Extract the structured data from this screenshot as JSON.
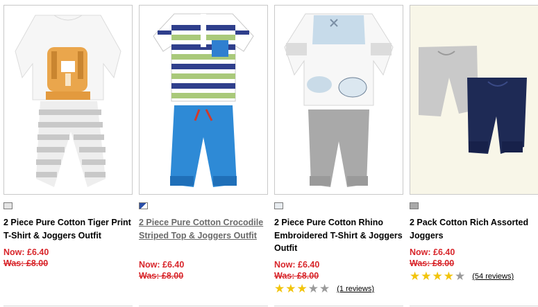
{
  "products": [
    {
      "swatch_color": "#e4e4e4",
      "title": "2 Piece Pure Cotton Tiger Print T-Shirt & Joggers Outfit",
      "now": "Now: £6.40",
      "was": "Was: £8.00"
    },
    {
      "swatch_color": "#2b4fa8",
      "title": "2 Piece Pure Cotton Crocodile Striped Top & Joggers Outfit",
      "now": "Now: £6.40",
      "was": "Was: £8.00"
    },
    {
      "swatch_color": "#e8ecf0",
      "title": "2 Piece Pure Cotton Rhino Embroidered T-Shirt & Joggers Outfit",
      "now": "Now: £6.40",
      "was": "Was: £8.00",
      "rating": 3,
      "rating_max": 5,
      "reviews": "(1 reviews)"
    },
    {
      "swatch_color": "#a9a9a9",
      "title": "2 Pack Cotton Rich Assorted Joggers",
      "now": "Now: £6.40",
      "was": "Was: £8.00",
      "rating": 4,
      "rating_max": 5,
      "reviews": "(54 reviews)"
    }
  ]
}
